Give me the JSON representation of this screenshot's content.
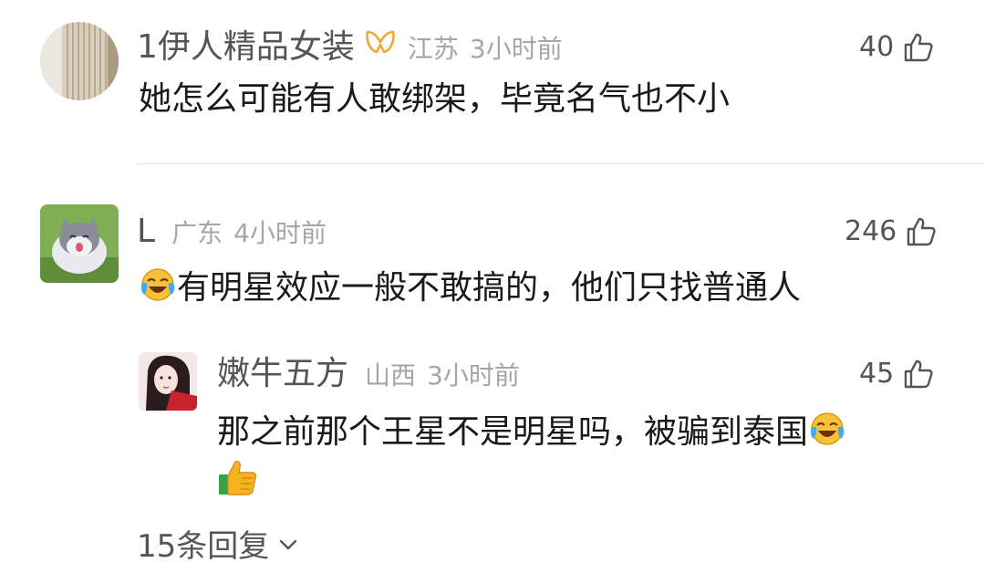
{
  "comments": [
    {
      "username": "1伊人精品女装",
      "location": "江苏",
      "time": "3小时前",
      "likes": "40",
      "text": "她怎么可能有人敢绑架，毕竟名气也不小"
    },
    {
      "username": "L",
      "location": "广东",
      "time": "4小时前",
      "likes": "246",
      "text": "有明星效应一般不敢搞的，他们只找普通人",
      "reply": {
        "username": "嫩牛五方",
        "location": "山西",
        "time": "3小时前",
        "likes": "45",
        "text": "那之前那个王星不是明星吗，被骗到泰国"
      }
    }
  ],
  "replies_link": "15条回复",
  "icons": {
    "like": "thumbs-up-outline-icon",
    "badge": "gold-ribbon-badge-icon",
    "laugh_cry": "laughing-crying-face-emoji",
    "thumbs_up": "thumbs-up-emoji",
    "expand": "chevron-down-icon"
  },
  "colors": {
    "text": "#1a1a1a",
    "username": "#555555",
    "meta": "#a6a6a6",
    "badge": "#f0a732"
  }
}
